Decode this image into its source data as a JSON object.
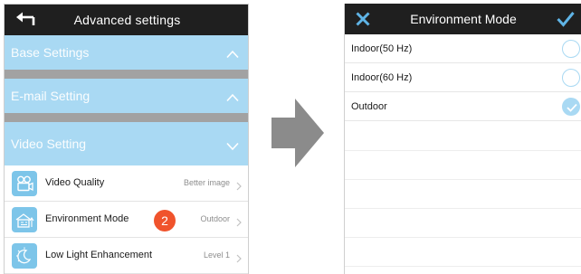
{
  "left": {
    "header": {
      "title": "Advanced settings",
      "back_icon": "back-arrow-icon"
    },
    "sections": [
      {
        "label": "Base Settings",
        "state": "expanded",
        "icon": "chevron-up-icon"
      },
      {
        "label": "E-mail Setting",
        "state": "expanded",
        "icon": "chevron-up-icon"
      },
      {
        "label": "Video Setting",
        "state": "collapsed",
        "icon": "chevron-down-icon"
      }
    ],
    "rows": [
      {
        "label": "Video Quality",
        "value": "Better image",
        "icon": "video-camera-icon"
      },
      {
        "label": "Environment Mode",
        "value": "Outdoor",
        "icon": "environment-icon"
      },
      {
        "label": "Low Light Enhancement",
        "value": "Level 1",
        "icon": "low-light-icon"
      }
    ],
    "step_badge": "2"
  },
  "arrow": {
    "icon": "right-arrow-icon"
  },
  "right": {
    "header": {
      "title": "Environment Mode",
      "close_icon": "close-icon",
      "confirm_icon": "checkmark-icon"
    },
    "options": [
      {
        "label": "Indoor(50 Hz)",
        "selected": false
      },
      {
        "label": "Indoor(60 Hz)",
        "selected": false
      },
      {
        "label": "Outdoor",
        "selected": true
      }
    ]
  },
  "colors": {
    "header_bg": "#1f1f1f",
    "section_bg": "#a9d9f3",
    "icon_bg": "#7dc5e9",
    "badge": "#f0532c",
    "arrow": "#8b8b8b"
  }
}
